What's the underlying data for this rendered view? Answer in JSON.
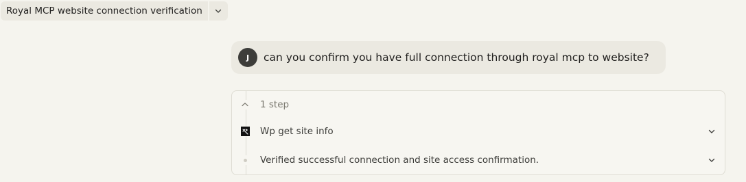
{
  "header": {
    "title": "Royal MCP website connection verification",
    "chevron_icon": "chevron-down-icon"
  },
  "user_message": {
    "avatar_initial": "J",
    "text": "can you confirm you have full connection through royal mcp to website?"
  },
  "steps": {
    "summary_label": "1 step",
    "summary_icon": "chevron-up-icon",
    "items": [
      {
        "label": "Wp get site info",
        "icon": "tool-icon",
        "expand_icon": "chevron-down-icon"
      },
      {
        "label": "Verified successful connection and site access confirmation.",
        "icon": "dot-icon",
        "expand_icon": "chevron-down-icon"
      }
    ]
  },
  "colors": {
    "background": "#f5f4ee",
    "bubble": "#ebe9e1",
    "avatar": "#3d3d3a",
    "border": "#dedcd3",
    "text": "#1f1e1d",
    "muted_text": "#7a786f"
  }
}
